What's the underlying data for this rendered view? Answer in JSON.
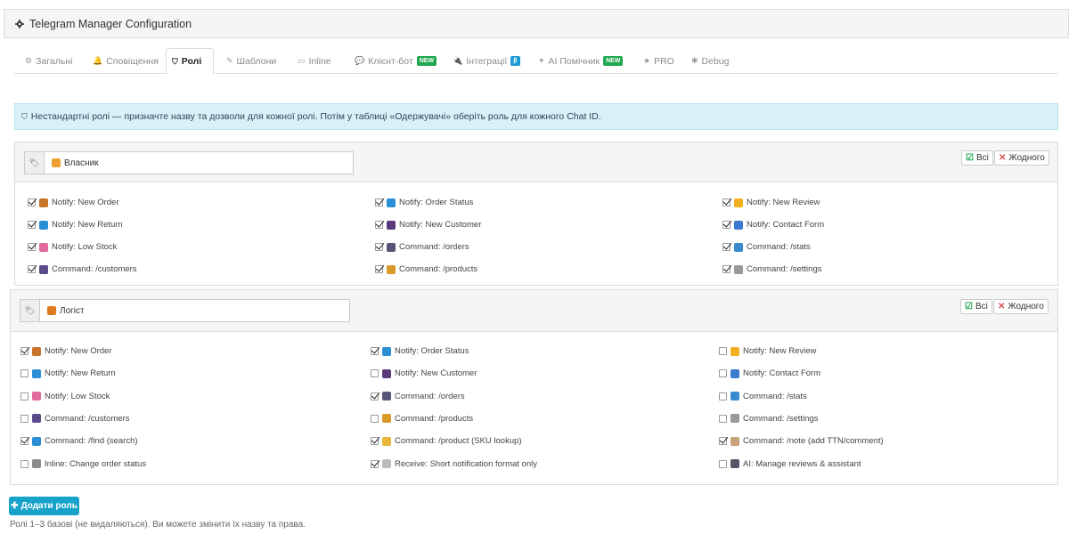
{
  "header": {
    "title": "Telegram Manager Configuration",
    "icon": "gear-icon"
  },
  "tabs": [
    {
      "label": "Загальні",
      "icon": "gear-icon",
      "badge": ""
    },
    {
      "label": "Сповіщення",
      "icon": "bell-icon",
      "badge": ""
    },
    {
      "label": "Ролі",
      "icon": "shield-icon",
      "badge": "",
      "active": true
    },
    {
      "label": "Шаблони",
      "icon": "edit-icon",
      "badge": ""
    },
    {
      "label": "Inline",
      "icon": "keyboard-icon",
      "badge": ""
    },
    {
      "label": "Клієнт-бот",
      "icon": "chat-icon",
      "badge": "NEW"
    },
    {
      "label": "Інтеграції",
      "icon": "plug-icon",
      "badge": "β"
    },
    {
      "label": "AI Помічник",
      "icon": "android-icon",
      "badge": "NEW"
    },
    {
      "label": "PRO",
      "icon": "star-icon",
      "badge": ""
    },
    {
      "label": "Debug",
      "icon": "bug-icon",
      "badge": ""
    }
  ],
  "alert": {
    "text": "Нестандартні ролі — призначте назву та дозволи для кожної ролі. Потім у таблиці «Одержувачі» оберіть роль для кожного Chat ID."
  },
  "buttons": {
    "all": "Всі",
    "none": "Жодного",
    "add_role": "Додати роль"
  },
  "roles": [
    {
      "name": "Власник",
      "permissions": [
        {
          "label": "Notify: New Order",
          "checked": true,
          "icon": "box-icon"
        },
        {
          "label": "Notify: Order Status",
          "checked": true,
          "icon": "refresh-icon"
        },
        {
          "label": "Notify: New Review",
          "checked": true,
          "icon": "star-icon"
        },
        {
          "label": "Notify: New Return",
          "checked": true,
          "icon": "return-icon"
        },
        {
          "label": "Notify: New Customer",
          "checked": true,
          "icon": "person-icon"
        },
        {
          "label": "Notify: Contact Form",
          "checked": true,
          "icon": "mailbox-icon"
        },
        {
          "label": "Notify: Low Stock",
          "checked": true,
          "icon": "chart-down-icon"
        },
        {
          "label": "Command: /orders",
          "checked": true,
          "icon": "tray-icon"
        },
        {
          "label": "Command: /stats",
          "checked": true,
          "icon": "bar-chart-icon"
        },
        {
          "label": "Command: /customers",
          "checked": true,
          "icon": "people-icon"
        },
        {
          "label": "Command: /products",
          "checked": true,
          "icon": "hourglass-icon"
        },
        {
          "label": "Command: /settings",
          "checked": true,
          "icon": "cog-icon"
        }
      ]
    },
    {
      "name": "Логіст",
      "permissions": [
        {
          "label": "Notify: New Order",
          "checked": true,
          "icon": "box-icon"
        },
        {
          "label": "Notify: Order Status",
          "checked": true,
          "icon": "refresh-icon"
        },
        {
          "label": "Notify: New Review",
          "checked": false,
          "icon": "star-icon"
        },
        {
          "label": "Notify: New Return",
          "checked": false,
          "icon": "return-icon"
        },
        {
          "label": "Notify: New Customer",
          "checked": false,
          "icon": "person-icon"
        },
        {
          "label": "Notify: Contact Form",
          "checked": false,
          "icon": "mailbox-icon"
        },
        {
          "label": "Notify: Low Stock",
          "checked": false,
          "icon": "chart-down-icon"
        },
        {
          "label": "Command: /orders",
          "checked": true,
          "icon": "tray-icon"
        },
        {
          "label": "Command: /stats",
          "checked": false,
          "icon": "bar-chart-icon"
        },
        {
          "label": "Command: /customers",
          "checked": false,
          "icon": "people-icon"
        },
        {
          "label": "Command: /products",
          "checked": false,
          "icon": "hourglass-icon"
        },
        {
          "label": "Command: /settings",
          "checked": false,
          "icon": "cog-icon"
        },
        {
          "label": "Command: /find (search)",
          "checked": true,
          "icon": "search-icon"
        },
        {
          "label": "Command: /product (SKU lookup)",
          "checked": true,
          "icon": "tag-icon"
        },
        {
          "label": "Command: /note (add TTN/comment)",
          "checked": true,
          "icon": "note-icon"
        },
        {
          "label": "Inline: Change order status",
          "checked": false,
          "icon": "circle-icon"
        },
        {
          "label": "Receive: Short notification format only",
          "checked": true,
          "icon": "doc-icon"
        },
        {
          "label": "AI: Manage reviews & assistant",
          "checked": false,
          "icon": "robot-icon"
        }
      ]
    }
  ],
  "footer_note": "Ролі 1–3 базові (не видаляються). Ви можете змінити їх назву та права."
}
